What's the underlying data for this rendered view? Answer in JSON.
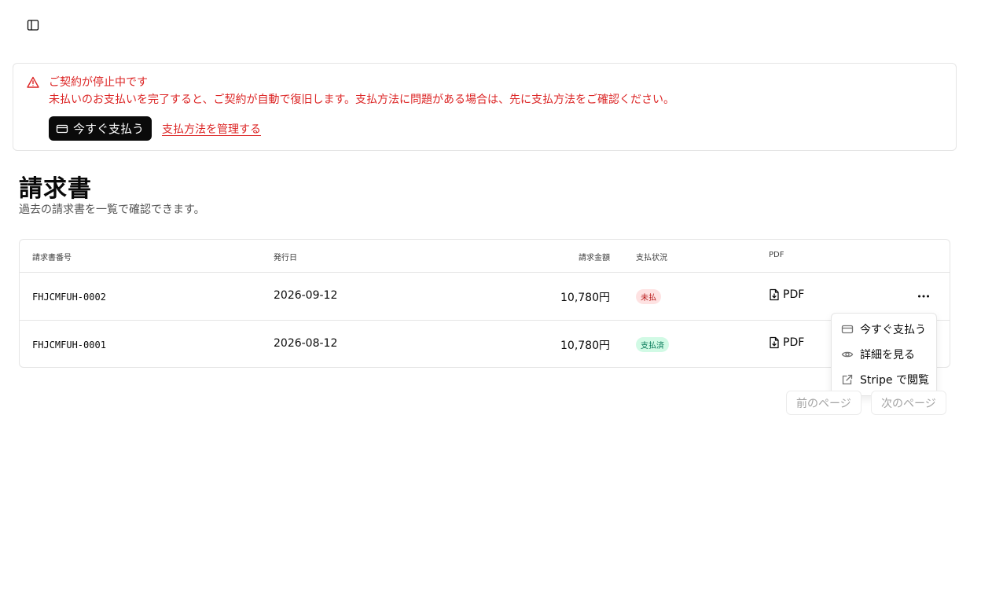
{
  "header": {
    "sidebar_toggle_icon": "panel-left-icon"
  },
  "alert": {
    "title": "ご契約が停止中です",
    "description": "未払いのお支払いを完了すると、ご契約が自動で復旧します。支払方法に問題がある場合は、先に支払方法をご確認ください。",
    "pay_now_label": "今すぐ支払う",
    "manage_payment_label": "支払方法を管理する",
    "color": "#dc2626"
  },
  "page": {
    "title": "請求書",
    "subtitle": "過去の請求書を一覧で確認できます。"
  },
  "table": {
    "columns": [
      "請求書番号",
      "発行日",
      "請求金額",
      "支払状況",
      "PDF"
    ],
    "rows": [
      {
        "number": "FHJCMFUH-0002",
        "date": "2026-09-12",
        "amount": "10,780円",
        "status": "未払",
        "pdf": "PDF"
      },
      {
        "number": "FHJCMFUH-0001",
        "date": "2026-08-12",
        "amount": "10,780円",
        "status": "支払済",
        "pdf": "PDF"
      }
    ]
  },
  "menu": {
    "items": [
      {
        "label": "今すぐ支払う",
        "icon": "credit-card-icon"
      },
      {
        "label": "詳細を見る",
        "icon": "eye-icon"
      },
      {
        "label": "Stripe で閲覧",
        "icon": "external-link-icon"
      }
    ]
  },
  "pagination": {
    "prev_label": "前のページ",
    "next_label": "次のページ"
  }
}
